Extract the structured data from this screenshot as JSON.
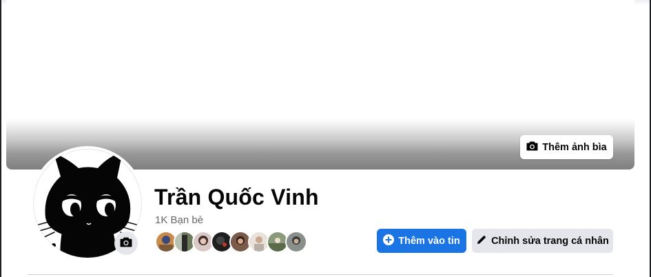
{
  "cover": {
    "add_cover_label": "Thêm ảnh bìa",
    "button_icon": "camera-icon"
  },
  "profile": {
    "name": "Trần Quốc Vinh",
    "friends_count": "1K Bạn bè",
    "avatar": "black-cat-avatar",
    "avatar_edit_icon": "camera-icon",
    "friend_avatar_colors": [
      "#c98b4a",
      "#6b7b5a",
      "#8e6f6a",
      "#1e1e1e",
      "#7a5a48",
      "#d9cfc4",
      "#8a9a7a",
      "#8b8f8c"
    ]
  },
  "actions": {
    "add_story_label": "Thêm vào tin",
    "add_story_icon": "plus-circle-icon",
    "edit_profile_label": "Chỉnh sửa trang cá nhân",
    "edit_profile_icon": "pencil-icon"
  },
  "colors": {
    "primary": "#1b74e4",
    "secondary_button": "#e4e6eb",
    "text_primary": "#050505",
    "text_secondary": "#65676b"
  }
}
